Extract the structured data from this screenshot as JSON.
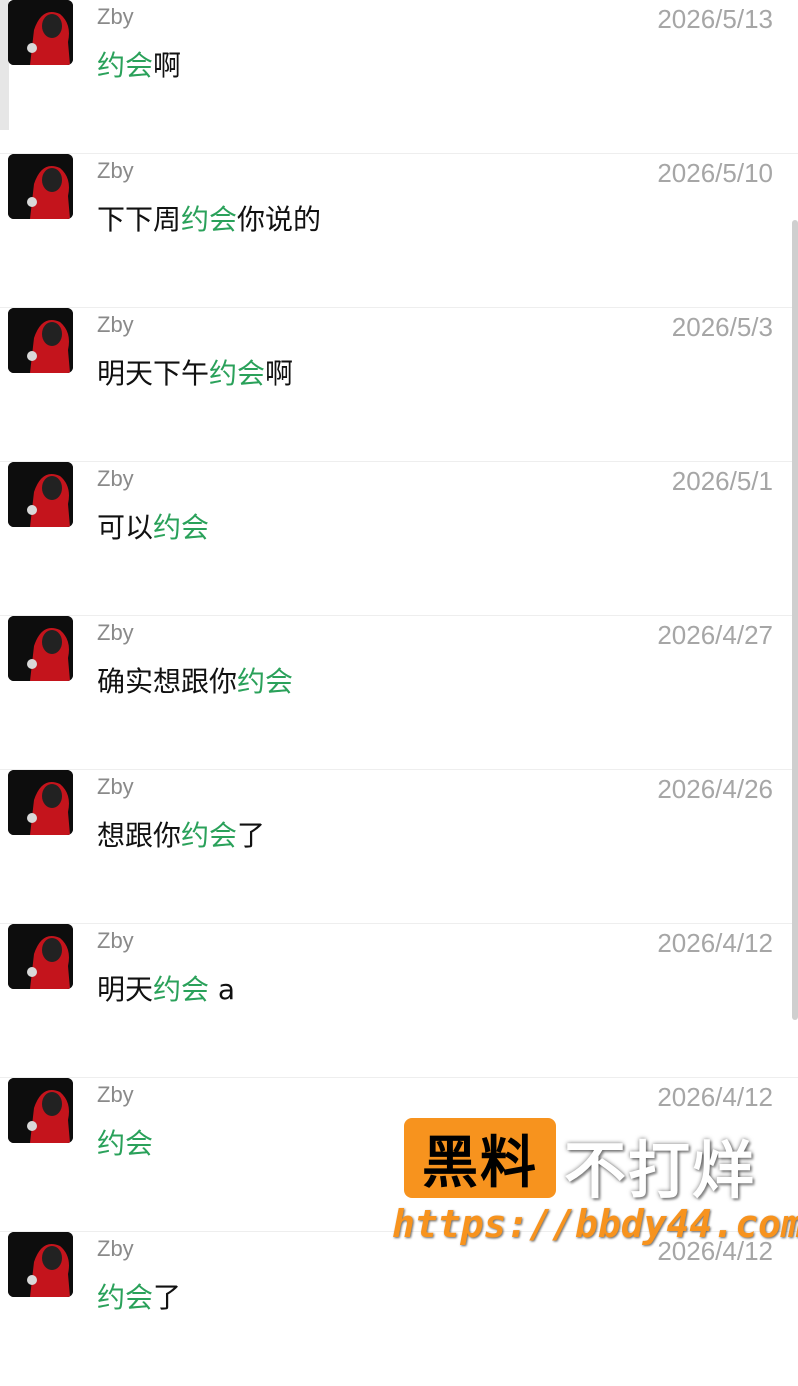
{
  "colors": {
    "highlight": "#2aa15a",
    "watermark_orange": "#f7931e"
  },
  "messages": [
    {
      "name": "Zby",
      "date": "2026/5/13",
      "pre": "",
      "hl": "约会",
      "post": "啊"
    },
    {
      "name": "Zby",
      "date": "2026/5/10",
      "pre": "下下周",
      "hl": "约会",
      "post": "你说的"
    },
    {
      "name": "Zby",
      "date": "2026/5/3",
      "pre": "明天下午",
      "hl": "约会",
      "post": "啊"
    },
    {
      "name": "Zby",
      "date": "2026/5/1",
      "pre": "可以",
      "hl": "约会",
      "post": ""
    },
    {
      "name": "Zby",
      "date": "2026/4/27",
      "pre": "确实想跟你",
      "hl": "约会",
      "post": ""
    },
    {
      "name": "Zby",
      "date": "2026/4/26",
      "pre": "想跟你",
      "hl": "约会",
      "post": "了"
    },
    {
      "name": "Zby",
      "date": "2026/4/12",
      "pre": "明天",
      "hl": "约会",
      "post": " a"
    },
    {
      "name": "Zby",
      "date": "2026/4/12",
      "pre": "",
      "hl": "约会",
      "post": ""
    },
    {
      "name": "Zby",
      "date": "2026/4/12",
      "pre": "",
      "hl": "约会",
      "post": "了"
    }
  ],
  "watermark": {
    "brand_box": "黑料",
    "brand_text": "不打烊",
    "url": "https://bbdy44.com"
  }
}
